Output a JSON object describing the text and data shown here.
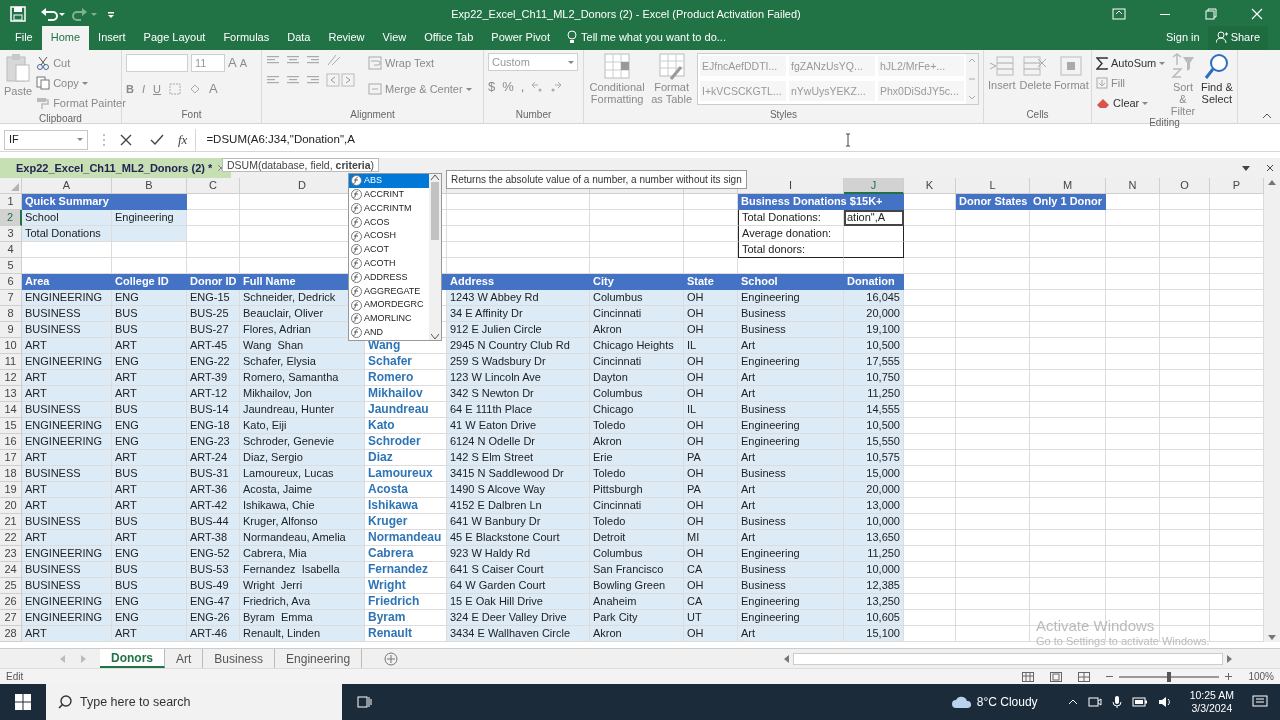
{
  "window": {
    "title": "Exp22_Excel_Ch11_ML2_Donors (2) - Excel (Product Activation Failed)"
  },
  "ribbon_tabs": [
    {
      "label": "File",
      "selected": false
    },
    {
      "label": "Home",
      "selected": true
    },
    {
      "label": "Insert",
      "selected": false
    },
    {
      "label": "Page Layout",
      "selected": false
    },
    {
      "label": "Formulas",
      "selected": false
    },
    {
      "label": "Data",
      "selected": false
    },
    {
      "label": "Review",
      "selected": false
    },
    {
      "label": "View",
      "selected": false
    },
    {
      "label": "Office Tab",
      "selected": false
    },
    {
      "label": "Power Pivot",
      "selected": false
    }
  ],
  "tell_me": "Tell me what you want to do...",
  "sign_in": "Sign in",
  "share": "Share",
  "clipboard": {
    "paste": "Paste",
    "cut": "Cut",
    "copy": "Copy",
    "format_painter": "Format Painter",
    "label": "Clipboard"
  },
  "font": {
    "size": "11",
    "size_buttons": [
      "A",
      "A"
    ],
    "buttons": [
      "B",
      "I",
      "U"
    ],
    "font_color": "A",
    "label": "Font"
  },
  "alignment": {
    "wrap_text": "Wrap Text",
    "merge_center": "Merge & Center",
    "label": "Alignment"
  },
  "number": {
    "format": "Custom",
    "buttons": [
      "$",
      "%",
      ","
    ],
    "label": "Number"
  },
  "styles": {
    "conditional_formatting": "Conditional Formatting",
    "format_as_table": "Format as Table",
    "gallery": [
      "EJfncAefDDTI...",
      "fgZANzUsYQ...",
      "hJL2/MrFe+...",
      "I+kVCSCKGTL...",
      "nYwUysYEKZ...",
      "Phx0DiSdJY5c..."
    ],
    "label": "Styles"
  },
  "cells": {
    "buttons": [
      "Insert",
      "Delete",
      "Format"
    ],
    "label": "Cells"
  },
  "editing": {
    "autosum": "AutoSum",
    "fill": "Fill",
    "clear": "Clear",
    "sort_filter": "Sort & Filter",
    "find_select": "Find & Select",
    "label": "Editing"
  },
  "formula_bar": {
    "name_box": "IF",
    "insert_function": "fx",
    "formula": "=DSUM(A6:J34,\"Donation\",A"
  },
  "workbook_tab": {
    "label": "Exp22_Excel_Ch11_ML2_Donors (2) *"
  },
  "function_tip": "DSUM(database, field, **criteria**)",
  "autocomplete": {
    "items": [
      {
        "label": "ABS",
        "selected": true
      },
      {
        "label": "ACCRINT",
        "selected": false
      },
      {
        "label": "ACCRINTM",
        "selected": false
      },
      {
        "label": "ACOS",
        "selected": false
      },
      {
        "label": "ACOSH",
        "selected": false
      },
      {
        "label": "ACOT",
        "selected": false
      },
      {
        "label": "ACOTH",
        "selected": false
      },
      {
        "label": "ADDRESS",
        "selected": false
      },
      {
        "label": "AGGREGATE",
        "selected": false
      },
      {
        "label": "AMORDEGRC",
        "selected": false
      },
      {
        "label": "AMORLINC",
        "selected": false
      },
      {
        "label": "AND",
        "selected": false
      }
    ],
    "description": "Returns the absolute value of a number, a number without its sign"
  },
  "columns": [
    {
      "label": "A",
      "selected": false
    },
    {
      "label": "B",
      "selected": false
    },
    {
      "label": "C",
      "selected": false
    },
    {
      "label": "D",
      "selected": false
    },
    {
      "selected": false
    },
    {
      "selected": false
    },
    {
      "selected": false
    },
    {
      "selected": false
    },
    {
      "label": "I",
      "selected": false
    },
    {
      "label": "J",
      "selected": true
    },
    {
      "label": "K",
      "selected": false
    },
    {
      "label": "L",
      "selected": false
    },
    {
      "label": "M",
      "selected": false
    },
    {
      "label": "N",
      "selected": false
    },
    {
      "label": "O",
      "selected": false
    },
    {
      "label": "P",
      "selected": false
    }
  ],
  "row_numbers": [
    {
      "label": "1",
      "selected": false
    },
    {
      "label": "2",
      "selected": true
    },
    {
      "label": "3",
      "selected": false
    },
    {
      "label": "4",
      "selected": false
    },
    {
      "label": "5",
      "selected": false
    },
    {
      "label": "6",
      "selected": false
    },
    {
      "label": "7",
      "selected": false
    },
    {
      "label": "8",
      "selected": false
    },
    {
      "label": "9",
      "selected": false
    },
    {
      "label": "10",
      "selected": false
    },
    {
      "label": "11",
      "selected": false
    },
    {
      "label": "12",
      "selected": false
    },
    {
      "label": "13",
      "selected": false
    },
    {
      "label": "14",
      "selected": false
    },
    {
      "label": "15",
      "selected": false
    },
    {
      "label": "16",
      "selected": false
    },
    {
      "label": "17",
      "selected": false
    },
    {
      "label": "18",
      "selected": false
    },
    {
      "label": "19",
      "selected": false
    },
    {
      "label": "20",
      "selected": false
    },
    {
      "label": "21",
      "selected": false
    },
    {
      "label": "22",
      "selected": false
    },
    {
      "label": "23",
      "selected": false
    },
    {
      "label": "24",
      "selected": false
    },
    {
      "label": "25",
      "selected": false
    },
    {
      "label": "26",
      "selected": false
    },
    {
      "label": "27",
      "selected": false
    },
    {
      "label": "28",
      "selected": false
    }
  ],
  "quick_summary": {
    "title": "Quick Summary",
    "rows": [
      {
        "label": "School",
        "value": "Engineering"
      },
      {
        "label": "Total Donations"
      }
    ]
  },
  "business_box": {
    "title": "Business Donations $15K+",
    "rows": [
      {
        "label": "Total Donations:",
        "value": "ation\",A",
        "editing": true
      },
      {
        "label": "Average donation:",
        "editing": false
      },
      {
        "label": "Total donors:",
        "editing": false
      }
    ]
  },
  "criteria_headers": [
    "Donor States",
    "Only 1 Donor"
  ],
  "donor_table": {
    "columns": [
      "Area",
      "College ID",
      "Donor ID",
      "Full Name",
      "Address",
      "City",
      "State",
      "School",
      "Donation"
    ],
    "rows": [
      {
        "cells": [
          "ENGINEERING",
          "ENG",
          "ENG-15",
          "Schneider, Dedrick",
          "1243 W Abbey Rd",
          "Columbus",
          "OH",
          "Engineering",
          "16,045"
        ]
      },
      {
        "cells": [
          "BUSINESS",
          "BUS",
          "BUS-25",
          "Beauclair, Oliver",
          "34 E Affinity Dr",
          "Cincinnati",
          "OH",
          "Business",
          "20,000"
        ]
      },
      {
        "cells": [
          "BUSINESS",
          "BUS",
          "BUS-27",
          "Flores, Adrian",
          "912 E Julien Circle",
          "Akron",
          "OH",
          "Business",
          "19,100"
        ]
      },
      {
        "cells": [
          "ART",
          "ART",
          "ART-45",
          "Wang  Shan",
          "2945 N Country Club Rd",
          "Chicago Heights",
          "IL",
          "Art",
          "10,500"
        ],
        "last_name": "Wang"
      },
      {
        "cells": [
          "ENGINEERING",
          "ENG",
          "ENG-22",
          "Schafer, Elysia",
          "259 S Wadsbury Dr",
          "Cincinnati",
          "OH",
          "Engineering",
          "17,555"
        ],
        "last_name": "Schafer"
      },
      {
        "cells": [
          "ART",
          "ART",
          "ART-39",
          "Romero, Samantha",
          "123 W Lincoln Ave",
          "Dayton",
          "OH",
          "Art",
          "10,750"
        ],
        "last_name": "Romero"
      },
      {
        "cells": [
          "ART",
          "ART",
          "ART-12",
          "Mikhailov, Jon",
          "342 S Newton Dr",
          "Columbus",
          "OH",
          "Art",
          "11,250"
        ],
        "last_name": "Mikhailov"
      },
      {
        "cells": [
          "BUSINESS",
          "BUS",
          "BUS-14",
          "Jaundreau, Hunter",
          "64 E 111th Place",
          "Chicago",
          "IL",
          "Business",
          "14,555"
        ],
        "last_name": "Jaundreau"
      },
      {
        "cells": [
          "ENGINEERING",
          "ENG",
          "ENG-18",
          "Kato, Eiji",
          "41 W Eaton Drive",
          "Toledo",
          "OH",
          "Engineering",
          "10,500"
        ],
        "last_name": "Kato"
      },
      {
        "cells": [
          "ENGINEERING",
          "ENG",
          "ENG-23",
          "Schroder, Genevie",
          "6124 N Odelle Dr",
          "Akron",
          "OH",
          "Engineering",
          "15,550"
        ],
        "last_name": "Schroder"
      },
      {
        "cells": [
          "ART",
          "ART",
          "ART-24",
          "Diaz, Sergio",
          "142 S Elm Street",
          "Erie",
          "PA",
          "Art",
          "10,575"
        ],
        "last_name": "Diaz"
      },
      {
        "cells": [
          "BUSINESS",
          "BUS",
          "BUS-31",
          "Lamoureux, Lucas",
          "3415 N Saddlewood Dr",
          "Toledo",
          "OH",
          "Business",
          "15,000"
        ],
        "last_name": "Lamoureux"
      },
      {
        "cells": [
          "ART",
          "ART",
          "ART-36",
          "Acosta, Jaime",
          "1490 S Alcove Way",
          "Pittsburgh",
          "PA",
          "Art",
          "20,000"
        ],
        "last_name": "Acosta"
      },
      {
        "cells": [
          "ART",
          "ART",
          "ART-42",
          "Ishikawa, Chie",
          "4152 E Dalbren Ln",
          "Cincinnati",
          "OH",
          "Art",
          "13,000"
        ],
        "last_name": "Ishikawa"
      },
      {
        "cells": [
          "BUSINESS",
          "BUS",
          "BUS-44",
          "Kruger, Alfonso",
          "641 W Banbury Dr",
          "Toledo",
          "OH",
          "Business",
          "10,000"
        ],
        "last_name": "Kruger"
      },
      {
        "cells": [
          "ART",
          "ART",
          "ART-38",
          "Normandeau, Amelia",
          "45 E Blackstone Court",
          "Detroit",
          "MI",
          "Art",
          "13,650"
        ],
        "last_name": "Normandeau"
      },
      {
        "cells": [
          "ENGINEERING",
          "ENG",
          "ENG-52",
          "Cabrera, Mia",
          "923 W Haldy Rd",
          "Columbus",
          "OH",
          "Engineering",
          "11,250"
        ],
        "last_name": "Cabrera"
      },
      {
        "cells": [
          "BUSINESS",
          "BUS",
          "BUS-53",
          "Fernandez  Isabella",
          "641 S Caiser Court",
          "San Francisco",
          "CA",
          "Business",
          "10,000"
        ],
        "last_name": "Fernandez"
      },
      {
        "cells": [
          "BUSINESS",
          "BUS",
          "BUS-49",
          "Wright  Jerri",
          "64 W Garden Court",
          "Bowling Green",
          "OH",
          "Business",
          "12,385"
        ],
        "last_name": "Wright"
      },
      {
        "cells": [
          "ENGINEERING",
          "ENG",
          "ENG-47",
          "Friedrich, Ava",
          "15 E Oak Hill Drive",
          "Anaheim",
          "CA",
          "Engineering",
          "13,250"
        ],
        "last_name": "Friedrich"
      },
      {
        "cells": [
          "ENGINEERING",
          "ENG",
          "ENG-26",
          "Byram  Emma",
          "324 E Deer Valley Drive",
          "Park City",
          "UT",
          "Engineering",
          "10,605"
        ],
        "last_name": "Byram"
      },
      {
        "cells": [
          "ART",
          "ART",
          "ART-46",
          "Renault, Linden",
          "3434 E Wallhaven Circle",
          "Akron",
          "OH",
          "Art",
          "15,100"
        ],
        "last_name": "Renault"
      }
    ]
  },
  "sheet_tabs": [
    {
      "label": "Donors",
      "selected": true
    },
    {
      "label": "Art",
      "selected": false
    },
    {
      "label": "Business",
      "selected": false
    },
    {
      "label": "Engineering",
      "selected": false
    }
  ],
  "status_bar": {
    "mode": "Edit",
    "zoom": "100%",
    "zoom_slider": {
      "level": 0.5
    }
  },
  "activation": {
    "title": "Activate Windows",
    "hint": "Go to Settings to activate Windows."
  },
  "taskbar": {
    "search_placeholder": "Type here to search",
    "weather": "8°C Cloudy",
    "time": "10:25 AM",
    "date": "3/3/2024"
  }
}
